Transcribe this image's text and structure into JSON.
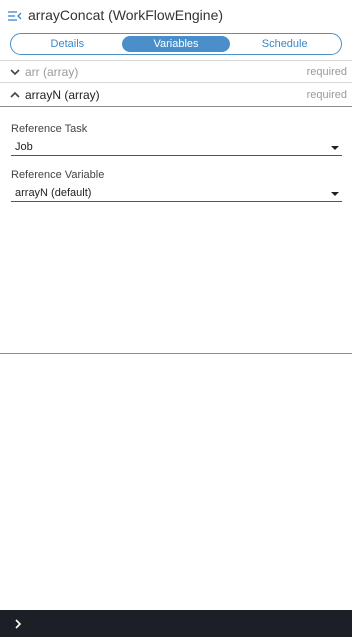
{
  "header": {
    "title": "arrayConcat (WorkFlowEngine)",
    "menu_icon": "collapse-menu-icon",
    "accent_color": "#3d86c6"
  },
  "tabs": [
    {
      "label": "Details",
      "active": false
    },
    {
      "label": "Variables",
      "active": true
    },
    {
      "label": "Schedule",
      "active": false
    }
  ],
  "variables": [
    {
      "name": "arr (array)",
      "status": "required",
      "expanded": false
    },
    {
      "name": "arrayN (array)",
      "status": "required",
      "expanded": true
    }
  ],
  "form": {
    "reference_task": {
      "label": "Reference Task",
      "value": "Job"
    },
    "reference_variable": {
      "label": "Reference Variable",
      "value": "arrayN (default)"
    }
  },
  "bottom_bar": {
    "icon": "chevron-right-icon",
    "background": "#1c1f26"
  }
}
